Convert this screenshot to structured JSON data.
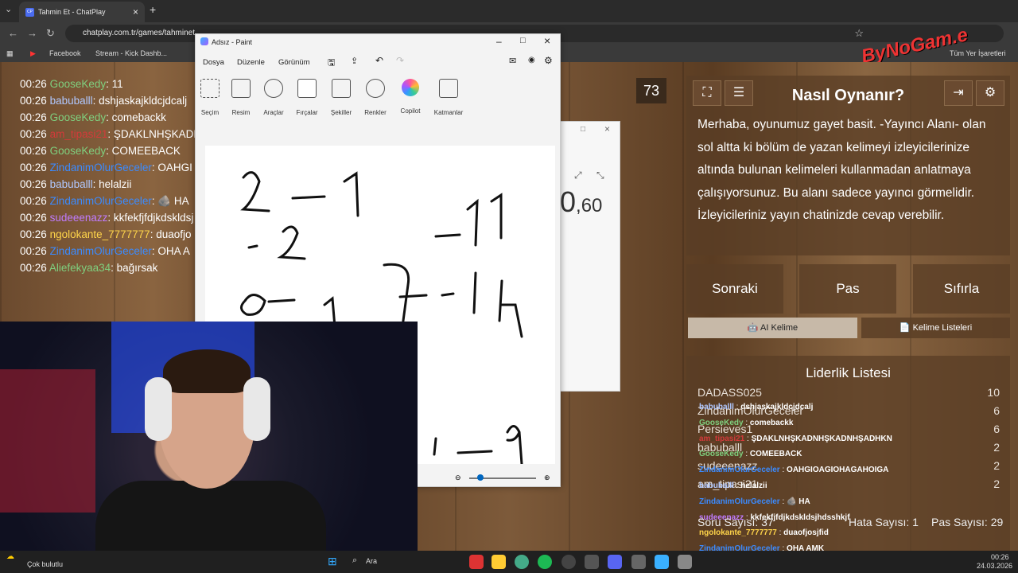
{
  "browser": {
    "tab_title": "Tahmin Et - ChatPlay",
    "tab_favicon": "CP",
    "url": "chatplay.com.tr/games/tahminet",
    "bookmarks": [
      "Facebook",
      "Stream - Kick Dashb..."
    ],
    "all_bookmarks": "Tüm Yer İşaretleri",
    "channel_logo": "ByNoGam.e"
  },
  "chat": [
    {
      "time": "00:26",
      "user": "GooseKedy",
      "color": "#7fd07f",
      "msg": "11"
    },
    {
      "time": "00:26",
      "user": "babuballl",
      "color": "#b0c8ff",
      "msg": "dshjaskajkldcjdcalj"
    },
    {
      "time": "00:26",
      "user": "GooseKedy",
      "color": "#7fd07f",
      "msg": "comebackk"
    },
    {
      "time": "00:26",
      "user": "am_tipasi21",
      "color": "#d33a3a",
      "msg": "ŞDAKLNHŞKADN"
    },
    {
      "time": "00:26",
      "user": "GooseKedy",
      "color": "#7fd07f",
      "msg": "COMEEBACK"
    },
    {
      "time": "00:26",
      "user": "ZindanimOlurGeceler",
      "color": "#3b8bff",
      "msg": "OAHGI"
    },
    {
      "time": "00:26",
      "user": "babuballl",
      "color": "#b0c8ff",
      "msg": "helalzii"
    },
    {
      "time": "00:26",
      "user": "ZindanimOlurGeceler",
      "color": "#3b8bff",
      "msg": "🪨 HA"
    },
    {
      "time": "00:26",
      "user": "sudeeenazz",
      "color": "#c07bff",
      "msg": "kkfekfjfdjkdskldsj"
    },
    {
      "time": "00:26",
      "user": "ngolokante_7777777",
      "color": "#ffd54a",
      "msg": "duaofjo"
    },
    {
      "time": "00:26",
      "user": "ZindanimOlurGeceler",
      "color": "#3b8bff",
      "msg": "OHA A"
    },
    {
      "time": "00:26",
      "user": "Aliefekyaa34",
      "color": "#7fd07f",
      "msg": "bağırsak"
    }
  ],
  "paint": {
    "title": "Adsız - Paint",
    "menu": [
      "Dosya",
      "Düzenle",
      "Görünüm"
    ],
    "tools": [
      "Seçim",
      "Resim",
      "Araçlar",
      "Fırçalar",
      "Şekiller",
      "Renkler",
      "Copilot",
      "Katmanlar"
    ]
  },
  "dialog": {
    "value_main": "0",
    "value_dec": ",60"
  },
  "game": {
    "counter": "73",
    "howto_title": "Nasıl Oynanır?",
    "howto_text": "Merhaba, oyunumuz gayet basit. -Yayıncı Alanı- olan sol altta ki bölüm de yazan kelimeyi izleyicilerinize altında bulunan kelimeleri kullanmadan anlatmaya çalışıyorsunuz. Bu alanı sadece yayıncı görmelidir. İzleyicileriniz yayın chatinizde cevap verebilir.",
    "buttons": [
      "Sonraki",
      "Pas",
      "Sıfırla"
    ],
    "ai_btn": "AI Kelime",
    "lists_btn": "Kelime Listeleri",
    "leaderboard_title": "Liderlik Listesi",
    "leaderboard": [
      {
        "name": "DADASS025",
        "score": "10"
      },
      {
        "name": "ZindanimOlurGeceler",
        "score": "6"
      },
      {
        "name": "Persieves1",
        "score": "6"
      },
      {
        "name": "babuballl",
        "score": "2"
      },
      {
        "name": "sudeeenazz",
        "score": "2"
      },
      {
        "name": "am_tipasi21",
        "score": "2"
      }
    ],
    "overlay": [
      {
        "user": "babuballl",
        "msg": "dshjaskajkldcjdcalj",
        "color": "#b0c8ff"
      },
      {
        "user": "GooseKedy",
        "msg": "comebackk",
        "color": "#7fd07f"
      },
      {
        "user": "am_tipasi21",
        "msg": "ŞDAKLNHŞKADNHŞKADNHŞADHKN",
        "color": "#d33a3a"
      },
      {
        "user": "GooseKedy",
        "msg": "COMEEBACK",
        "color": "#7fd07f"
      },
      {
        "user": "ZindanimOlurGeceler",
        "msg": "OAHGIOAGIOHAGAHOIGA",
        "color": "#3b8bff"
      },
      {
        "user": "babuballl",
        "msg": "helalzii",
        "color": "#b0c8ff"
      },
      {
        "user": "ZindanimOlurGeceler",
        "msg": "🪨 HA",
        "color": "#3b8bff"
      },
      {
        "user": "sudeeenazz",
        "msg": "kkfekfjfdjkdskldsjhdsshkjf",
        "color": "#c07bff"
      },
      {
        "user": "ngolokante_7777777",
        "msg": "duaofjosjfid",
        "color": "#ffd54a"
      },
      {
        "user": "ZindanimOlurGeceler",
        "msg": "OHA AMK",
        "color": "#3b8bff"
      },
      {
        "user": "Aliefekyaa34",
        "msg": "bağırsak",
        "color": "#7fd07f"
      }
    ],
    "stats": {
      "soru": "Soru Sayısı: 37",
      "hata": "Hata Sayısı: 1",
      "pas": "Pas Sayısı: 29"
    }
  },
  "taskbar": {
    "weather": "Çok bulutlu",
    "search": "Ara",
    "time": "00:26",
    "date": "24.03.2026"
  }
}
